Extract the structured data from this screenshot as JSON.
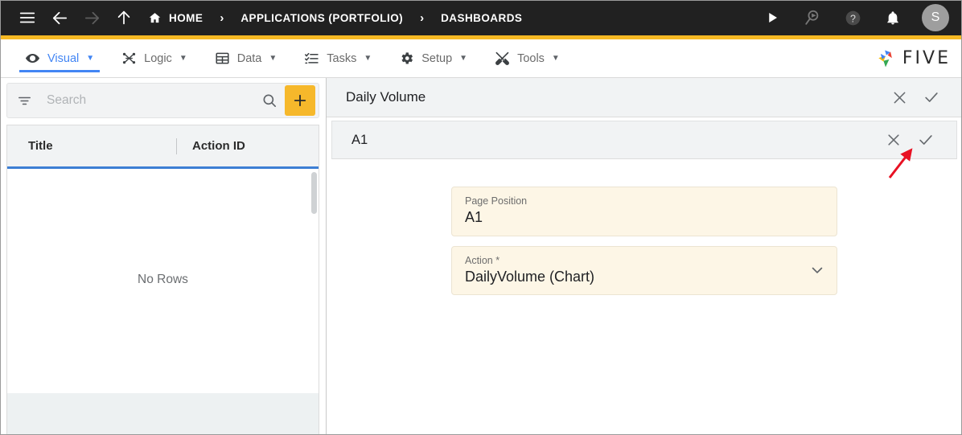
{
  "topbar": {
    "menu_icon": "hamburger-icon",
    "back_icon": "arrow-left-icon",
    "forward_icon": "arrow-right-icon",
    "up_icon": "arrow-up-icon",
    "breadcrumbs": [
      {
        "label": "HOME",
        "icon": "home-icon"
      },
      {
        "label": "APPLICATIONS (PORTFOLIO)",
        "icon": ""
      },
      {
        "label": "DASHBOARDS",
        "icon": ""
      }
    ],
    "separator": "›",
    "actions": [
      {
        "name": "run-icon",
        "glyph": "play"
      },
      {
        "name": "search-run-icon",
        "glyph": "search-play"
      },
      {
        "name": "help-icon",
        "glyph": "question"
      },
      {
        "name": "notifications-icon",
        "glyph": "bell"
      }
    ],
    "avatar_initial": "S",
    "accent_color": "#f6b924",
    "background_color": "#212121"
  },
  "menubar": {
    "items": [
      {
        "label": "Visual",
        "icon": "eye-icon",
        "active": true
      },
      {
        "label": "Logic",
        "icon": "logic-nodes-icon",
        "active": false
      },
      {
        "label": "Data",
        "icon": "table-grid-icon",
        "active": false
      },
      {
        "label": "Tasks",
        "icon": "checklist-icon",
        "active": false
      },
      {
        "label": "Setup",
        "icon": "gear-icon",
        "active": false
      },
      {
        "label": "Tools",
        "icon": "tools-icon",
        "active": false
      }
    ],
    "caret": "▼",
    "active_color": "#4285f4",
    "brand": "FIVE"
  },
  "sidebar": {
    "search": {
      "placeholder": "Search",
      "value": "",
      "filter_icon": "filter-icon",
      "search_icon": "search-icon"
    },
    "add_button_label": "+",
    "add_button_color": "#f6b82b",
    "table": {
      "columns": [
        "Title",
        "Action ID"
      ],
      "rows": [],
      "empty_message": "No Rows"
    }
  },
  "panel": {
    "header": {
      "title": "Daily Volume",
      "close_icon": "close-icon",
      "confirm_icon": "check-icon"
    },
    "subheader": {
      "title": "A1",
      "close_icon": "close-icon",
      "confirm_icon": "check-icon"
    },
    "fields": [
      {
        "label": "Page Position",
        "value": "A1",
        "type": "text"
      },
      {
        "label": "Action *",
        "value": "DailyVolume (Chart)",
        "type": "select",
        "chevron": "chevron-down-icon"
      }
    ]
  },
  "annotation": {
    "arrow_color": "#e81123",
    "points_to": "subheader-confirm-icon"
  }
}
